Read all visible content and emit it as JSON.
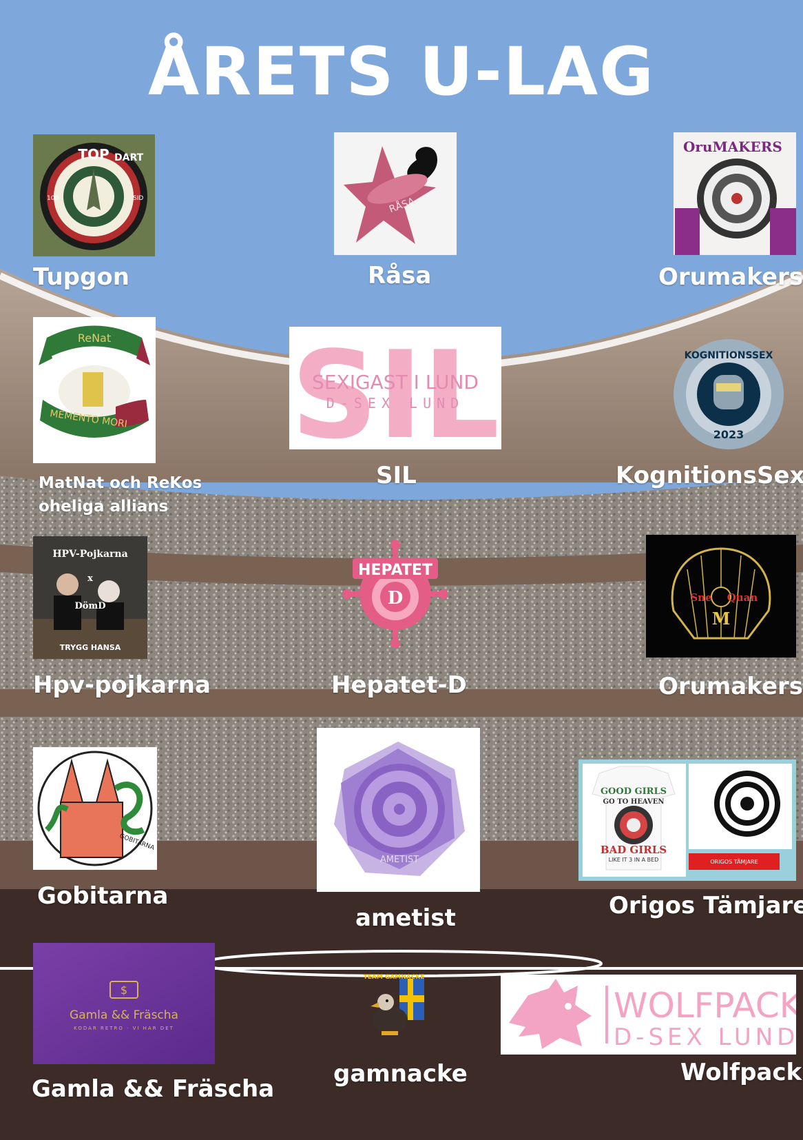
{
  "title": "ÅRETS U-LAG",
  "colors": {
    "sky": "#7ea8dc",
    "floor": "#3c2b26",
    "text": "#ffffff"
  },
  "teams": [
    {
      "name": "Tupgon",
      "logo_text": [
        "TOP",
        "DART",
        "100",
        "SID"
      ]
    },
    {
      "name": "Råsa",
      "logo_text": [
        "RÅSA"
      ]
    },
    {
      "name": "Orumakers",
      "logo_text": [
        "OruMAKERS"
      ]
    },
    {
      "name": "MatNat och ReKos oheliga allians",
      "logo_text": [
        "ReNat",
        "MEMENTO MORI"
      ]
    },
    {
      "name": "SIL",
      "logo_text": [
        "SIL",
        "SEXIGAST I LUND",
        "D-SEX LUND"
      ]
    },
    {
      "name": "KognitionsSex",
      "logo_text": [
        "KOGNITIONSSEX",
        "2023"
      ]
    },
    {
      "name": "Hpv-pojkarna",
      "logo_text": [
        "HPV-Pojkarna",
        "x",
        "DömD",
        "TRYGG HANSA"
      ]
    },
    {
      "name": "Hepatet-D",
      "logo_text": [
        "HEPATET",
        "D"
      ]
    },
    {
      "name": "Orumakers",
      "logo_text": [
        "Sne",
        "Quan",
        "M"
      ]
    },
    {
      "name": "Gobitarna",
      "logo_text": [
        "GOBITARNA"
      ]
    },
    {
      "name": "ametist",
      "logo_text": [
        "AMETIST"
      ]
    },
    {
      "name": "Origos Tämjare",
      "logo_text": [
        "GOOD GIRLS",
        "GO TO HEAVEN",
        "BAD GIRLS",
        "LIKE IT 3 IN A BED",
        "ORIGOS TÄMJARE"
      ]
    },
    {
      "name": "Gamla && Fräscha",
      "logo_text": [
        "Gamla && Fräscha",
        "KODAR RETRO · VI HAR DET"
      ]
    },
    {
      "name": "gamnacke",
      "logo_text": [
        "TEAM GAMNACKE"
      ]
    },
    {
      "name": "Wolfpack",
      "logo_text": [
        "WOLFPACK",
        "D-SEX LUND"
      ]
    }
  ]
}
